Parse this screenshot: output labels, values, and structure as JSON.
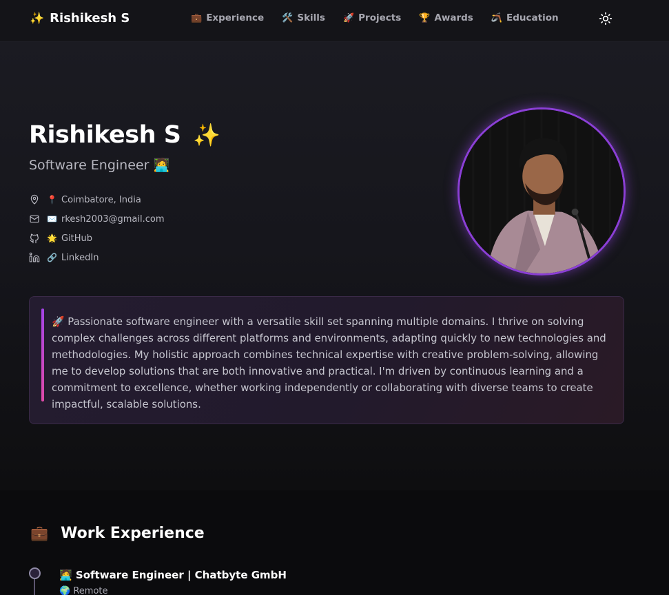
{
  "header": {
    "brand": {
      "icon": "✨",
      "name": "Rishikesh S"
    },
    "nav": [
      {
        "icon": "💼",
        "label": "Experience"
      },
      {
        "icon": "🛠️",
        "label": "Skills"
      },
      {
        "icon": "🚀",
        "label": "Projects"
      },
      {
        "icon": "🏆",
        "label": "Awards"
      },
      {
        "icon": "🪃",
        "label": "Education"
      }
    ],
    "theme_toggle_icon": "sun-icon"
  },
  "hero": {
    "name": "Rishikesh S",
    "name_icon": "✨",
    "role": "Software Engineer",
    "role_icon": "🧑‍💻",
    "contacts": [
      {
        "line_icon": "map-pin-icon",
        "emoji": "📍",
        "text": "Coimbatore, India"
      },
      {
        "line_icon": "mail-icon",
        "emoji": "✉️",
        "text": "rkesh2003@gmail.com"
      },
      {
        "line_icon": "github-icon",
        "emoji": "🌟",
        "text": "GitHub"
      },
      {
        "line_icon": "linkedin-icon",
        "emoji": "🔗",
        "text": "LinkedIn"
      }
    ],
    "about": "🚀 Passionate software engineer with a versatile skill set spanning multiple domains. I thrive on solving complex challenges across different platforms and environments, adapting quickly to new technologies and methodologies. My holistic approach combines technical expertise with creative problem-solving, allowing me to develop solutions that are both innovative and practical. I'm driven by continuous learning and a commitment to excellence, whether working independently or collaborating with diverse teams to create impactful, scalable solutions."
  },
  "experience": {
    "icon": "💼",
    "title": "Work Experience",
    "jobs": [
      {
        "icon": "🧑‍💻",
        "title": "Software Engineer | Chatbyte GmbH",
        "loc_icon": "🌍",
        "location": "Remote"
      }
    ]
  },
  "colors": {
    "accent_purple": "#8b3fd6",
    "accent_pink": "#e04aa8",
    "background": "#0b0b0d",
    "header": "#141418"
  }
}
